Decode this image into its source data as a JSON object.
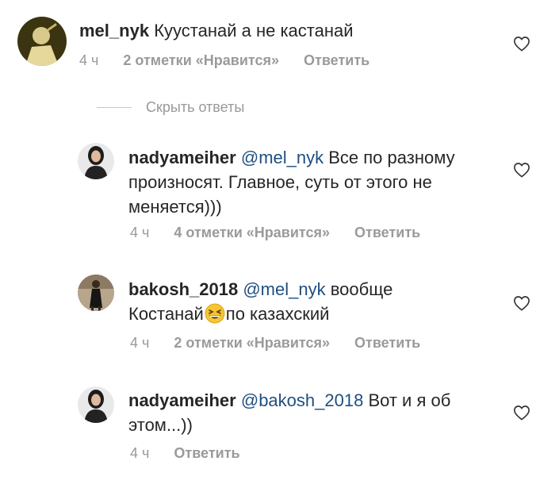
{
  "comments": [
    {
      "username": "mel_nyk",
      "text": "Куустанай а не кастанай",
      "time": "4 ч",
      "likes": "2 отметки «Нравится»",
      "reply": "Ответить"
    },
    {
      "username": "nadyameiher",
      "mention": "@mel_nyk",
      "text_line1": "Все по разному",
      "text_line2": "произносят. Главное, суть от этого не",
      "text_line3": "меняется)))",
      "time": "4 ч",
      "likes": "4 отметки «Нравится»",
      "reply": "Ответить"
    },
    {
      "username": "bakosh_2018",
      "mention": "@mel_nyk",
      "text_line1": "вообще",
      "text_line2a": "Костанай",
      "emoji": "grinning-squinting-face-emoji",
      "text_line2b": "по казахский",
      "time": "4 ч",
      "likes": "2 отметки «Нравится»",
      "reply": "Ответить"
    },
    {
      "username": "nadyameiher",
      "mention": "@bakosh_2018",
      "text_line1": "Вот и я об",
      "text_line2": "этом...))",
      "time": "4 ч",
      "reply": "Ответить"
    }
  ],
  "hide_replies_label": "Скрыть ответы",
  "icons": {
    "like": "heart-outline-icon"
  },
  "colors": {
    "mention": "#1f4f7f",
    "meta": "#999999",
    "text": "#262626"
  }
}
